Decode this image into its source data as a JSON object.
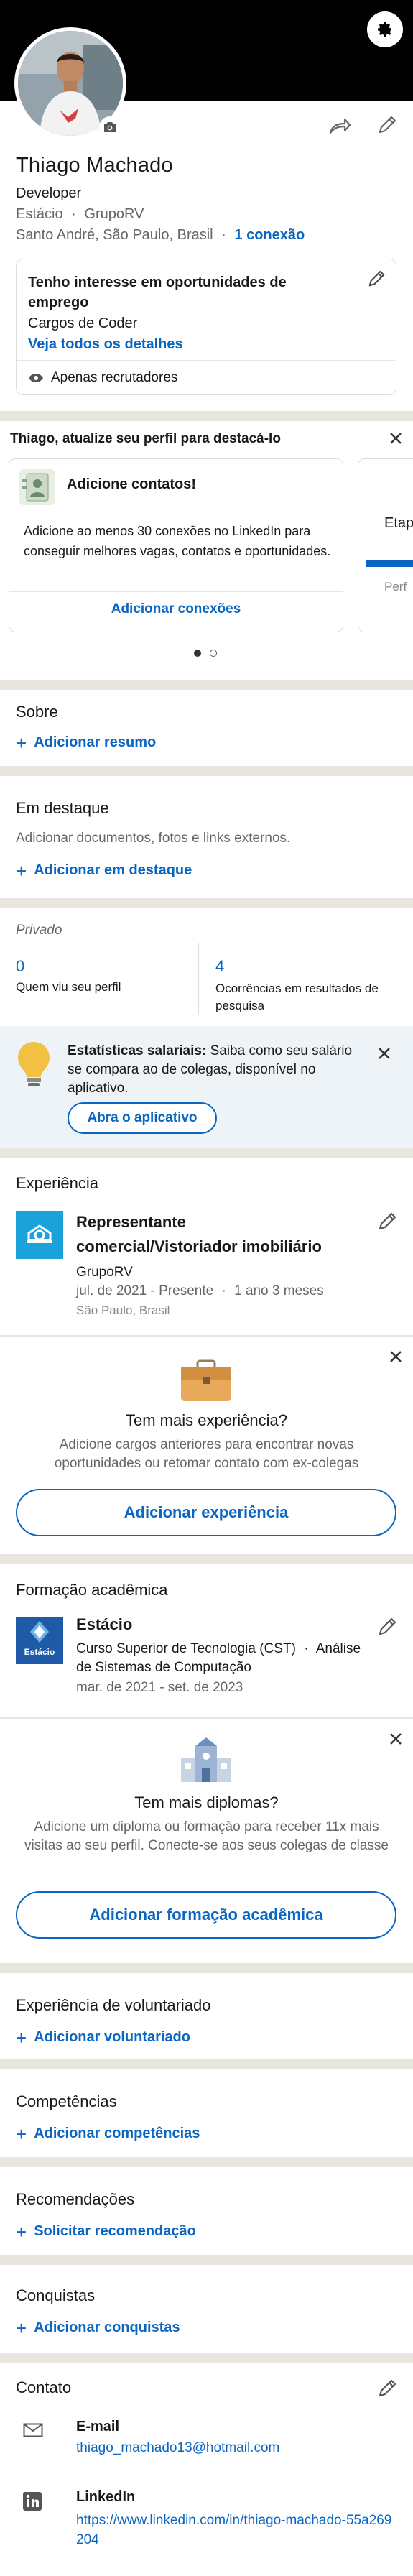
{
  "profile": {
    "name": "Thiago Machado",
    "headline": "Developer",
    "company": "Estácio",
    "separator": "·",
    "group": "GrupoRV",
    "location": "Santo André, São Paulo, Brasil",
    "connections": "1 conexão"
  },
  "open_to_work": {
    "title": "Tenho interesse em oportunidades de emprego",
    "role": "Cargos de Coder",
    "details_link": "Veja todos os detalhes",
    "visibility": "Apenas recrutadores"
  },
  "promo": {
    "title": "Thiago, atualize seu perfil para destacá-lo",
    "card_title": "Adicione contatos!",
    "card_body": "Adicione ao menos 30 conexões no LinkedIn para conseguir melhores vagas, contatos e oportunidades.",
    "card_action": "Adicionar conexões",
    "next_card_title": "Etap",
    "next_card_sub": "Perf"
  },
  "about": {
    "title": "Sobre",
    "action": "Adicionar resumo"
  },
  "featured": {
    "title": "Em destaque",
    "description": "Adicionar documentos, fotos e links externos.",
    "action": "Adicionar em destaque"
  },
  "analytics": {
    "label": "Privado",
    "profile_views": "0",
    "profile_views_label": "Quem viu seu perfil",
    "search_appearances": "4",
    "search_appearances_label": "Ocorrências em resultados de pesquisa"
  },
  "salary": {
    "bold": "Estatísticas salariais:",
    "text": " Saiba como seu salário se compara ao de colegas, disponível no aplicativo.",
    "action": "Abra o aplicativo"
  },
  "experience": {
    "title": "Experiência",
    "role": "Representante comercial/Vistoriador imobiliário",
    "company": "GrupoRV",
    "dates": "jul. de 2021 - Presente",
    "duration": "1 ano 3 meses",
    "location": "São Paulo, Brasil",
    "prompt_title": "Tem mais experiência?",
    "prompt_body": "Adicione cargos anteriores para encontrar novas oportunidades ou retomar contato com ex-colegas",
    "prompt_action": "Adicionar experiência"
  },
  "education": {
    "title": "Formação acadêmica",
    "school": "Estácio",
    "logo_text": "Estácio",
    "degree": "Curso Superior de Tecnologia (CST)",
    "field": "Análise de Sistemas de Computação",
    "dates": "mar. de 2021 - set. de 2023",
    "prompt_title": "Tem mais diplomas?",
    "prompt_body": "Adicione um diploma ou formação para receber 11x mais visitas ao seu perfil. Conecte-se aos seus colegas de classe",
    "prompt_action": "Adicionar formação acadêmica"
  },
  "volunteering": {
    "title": "Experiência de voluntariado",
    "action": "Adicionar voluntariado"
  },
  "skills": {
    "title": "Competências",
    "action": "Adicionar competências"
  },
  "recommendations": {
    "title": "Recomendações",
    "action": "Solicitar recomendação"
  },
  "accomplishments": {
    "title": "Conquistas",
    "action": "Adicionar conquistas"
  },
  "contact": {
    "title": "Contato",
    "email_label": "E-mail",
    "email": "thiago_machado13@hotmail.com",
    "linkedin_label": "LinkedIn",
    "linkedin_url": "https://www.linkedin.com/in/thiago-machado-55a269204"
  },
  "colors": {
    "brand_blue": "#0a66c2",
    "header_bg": "#000000",
    "separator": "#e9e5df",
    "experience_logo": "#1aa3d9",
    "education_logo": "#1e5aa8"
  }
}
